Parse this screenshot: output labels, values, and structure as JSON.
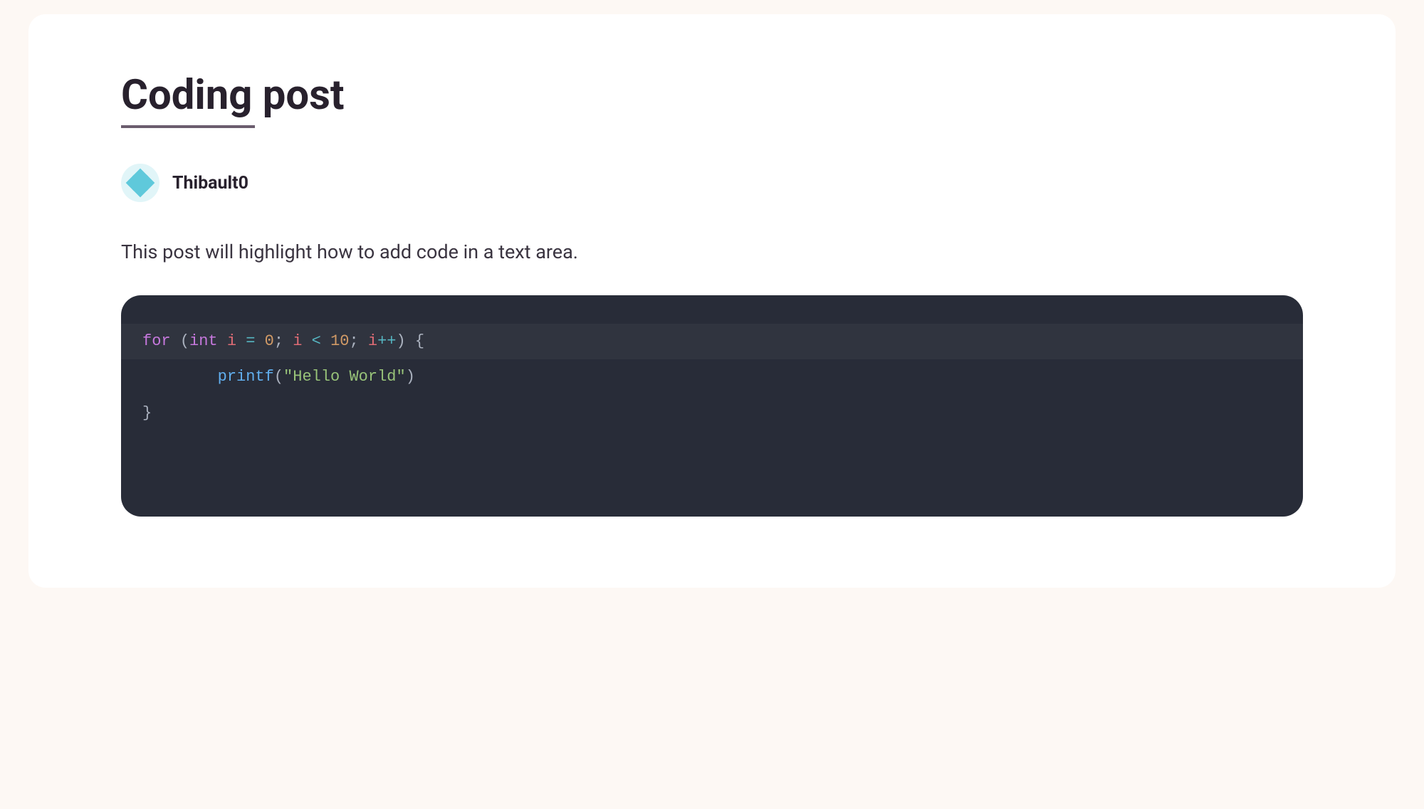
{
  "post": {
    "title": "Coding post",
    "author": "Thibault0",
    "description": "This post will highlight how to add code in a text area.",
    "code": {
      "line1": {
        "for": "for",
        "space1": " ",
        "paren_open": "(",
        "int": "int",
        "space2": " ",
        "i1": "i",
        "space3": " ",
        "eq": "=",
        "space4": " ",
        "zero": "0",
        "semi1": ";",
        "space5": " ",
        "i2": "i",
        "space6": " ",
        "lt": "<",
        "space7": " ",
        "ten": "10",
        "semi2": ";",
        "space8": " ",
        "i3": "i",
        "plusplus": "++",
        "paren_close": ")",
        "space9": " ",
        "brace_open": "{"
      },
      "line2": {
        "indent": "        ",
        "printf": "printf",
        "paren_open": "(",
        "string": "\"Hello World\"",
        "paren_close": ")"
      },
      "line3": {
        "brace_close": "}"
      }
    }
  }
}
